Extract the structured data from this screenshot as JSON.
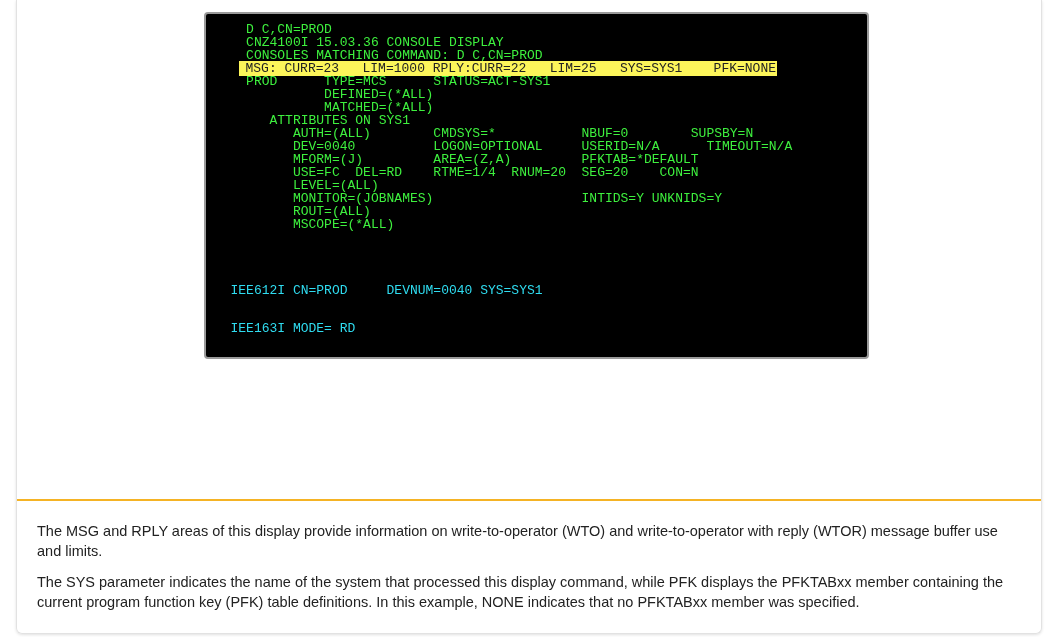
{
  "terminal": {
    "blocks": [
      {
        "lines": [
          {
            "kind": "output",
            "text": "  D C,CN=PROD"
          },
          {
            "kind": "output",
            "text": "  CNZ4100I 15.03.36 CONSOLE DISPLAY"
          },
          {
            "kind": "output",
            "text": "  CONSOLES MATCHING COMMAND: D C,CN=PROD"
          },
          {
            "kind": "highlight",
            "text": "MSG: CURR=23   LIM=1000 RPLY:CURR=22   LIM=25   SYS=SYS1    PFK=NONE"
          },
          {
            "kind": "output",
            "text": "  PROD      TYPE=MCS      STATUS=ACT-SYS1"
          },
          {
            "kind": "output",
            "text": "            DEFINED=(*ALL)"
          },
          {
            "kind": "output",
            "text": "            MATCHED=(*ALL)"
          },
          {
            "kind": "output",
            "text": "     ATTRIBUTES ON SYS1"
          },
          {
            "kind": "output",
            "text": "        AUTH=(ALL)        CMDSYS=*           NBUF=0        SUPSBY=N"
          },
          {
            "kind": "output",
            "text": "        DEV=0040          LOGON=OPTIONAL     USERID=N/A      TIMEOUT=N/A"
          },
          {
            "kind": "output",
            "text": "        MFORM=(J)         AREA=(Z,A)         PFKTAB=*DEFAULT"
          },
          {
            "kind": "output",
            "text": "        USE=FC  DEL=RD    RTME=1/4  RNUM=20  SEG=20    CON=N"
          },
          {
            "kind": "output",
            "text": "        LEVEL=(ALL)"
          },
          {
            "kind": "output",
            "text": "        MONITOR=(JOBNAMES)                   INTIDS=Y UNKNIDS=Y"
          },
          {
            "kind": "output",
            "text": "        ROUT=(ALL)"
          },
          {
            "kind": "output",
            "text": "        MSCOPE=(*ALL)"
          }
        ]
      },
      {
        "lines": [
          {
            "kind": "message",
            "text": "IEE612I CN=PROD     DEVNUM=0040 SYS=SYS1"
          }
        ]
      },
      {
        "lines": [
          {
            "kind": "message",
            "text": "IEE163I MODE= RD"
          }
        ]
      }
    ]
  },
  "paragraphs": [
    "The MSG and RPLY areas of this display provide information on write-to-operator (WTO) and write-to-operator with reply (WTOR) message buffer use and limits.",
    "The SYS parameter indicates the name of the system that processed this display command, while PFK displays the PFKTABxx member containing the current program function key (PFK) table definitions. In this example, NONE indicates that no PFKTABxx member was specified."
  ]
}
